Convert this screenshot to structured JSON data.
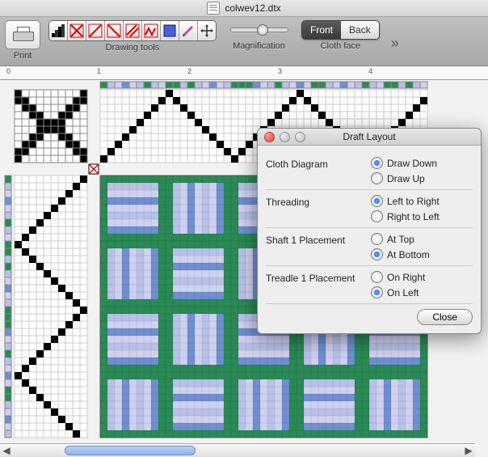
{
  "file": {
    "name": "colwev12.dtx"
  },
  "toolbar": {
    "print": "Print",
    "drawing_tools": "Drawing tools",
    "magnification": "Magnification",
    "cloth_face": "Cloth face",
    "front": "Front",
    "back": "Back",
    "active_face": "front",
    "tool_icons": [
      "ramp",
      "x-red",
      "diag1-red",
      "diag2-red",
      "diag3-red",
      "zig-red",
      "blue-box",
      "pencil",
      "move"
    ]
  },
  "ruler": {
    "marks": [
      "0",
      "1",
      "2",
      "3",
      "4"
    ]
  },
  "panel": {
    "title": "Draft Layout",
    "close": "Close",
    "rows": [
      {
        "label": "Cloth Diagram",
        "options": [
          "Draw Down",
          "Draw Up"
        ],
        "selected": 0
      },
      {
        "label": "Threading",
        "options": [
          "Left to Right",
          "Right to Left"
        ],
        "selected": 0
      },
      {
        "label": "Shaft 1 Placement",
        "options": [
          "At Top",
          "At Bottom"
        ],
        "selected": 1
      },
      {
        "label": "Treadle 1 Placement",
        "options": [
          "On Right",
          "On Left"
        ],
        "selected": 1
      }
    ]
  },
  "colors": {
    "green": "#2a8a55",
    "blue1": "#6f8fd0",
    "blue2": "#b8c2e8",
    "lav": "#d0d0f0",
    "grid": "#999"
  }
}
